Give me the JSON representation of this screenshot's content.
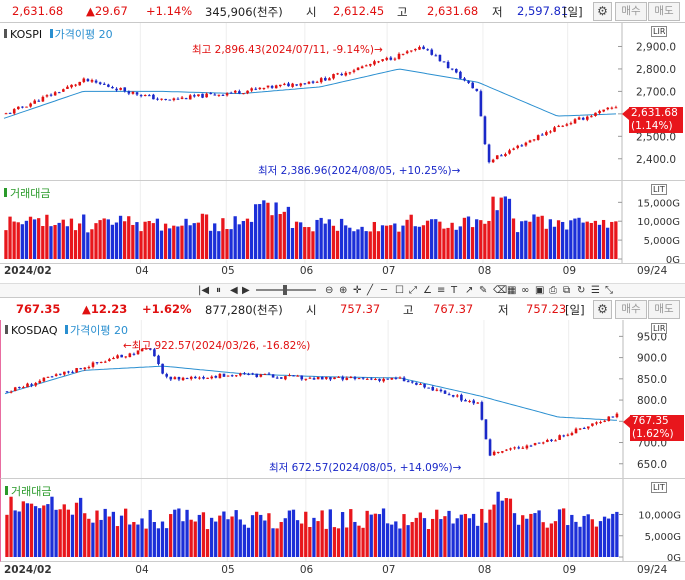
{
  "top": {
    "header": {
      "price": "2,631.68",
      "change": "▲29.67",
      "change_pct": "+1.14%",
      "volume": "345,906(천주)",
      "open_label": "시",
      "open": "2,612.45",
      "high_label": "고",
      "high": "2,631.68",
      "low_label": "저",
      "low": "2,597.81",
      "period": "[일]",
      "btn_sell": "매수",
      "btn_buy": "매도"
    },
    "legend": {
      "index_name": "KOSPI",
      "ma_label": "가격이평 20"
    },
    "vol_legend": "거래대금",
    "annotations": {
      "high": "최고 2,896.43(2024/07/11, -9.14%)",
      "low": "최저 2,386.96(2024/08/05, +10.25%)"
    },
    "current_price": "2,631.68",
    "current_pct": "(1.14%)",
    "vol_ticks": [
      "15,000G",
      "10,000G",
      "5,000G",
      "0G"
    ]
  },
  "bottom": {
    "header": {
      "price": "767.35",
      "change": "▲12.23",
      "change_pct": "+1.62%",
      "volume": "877,280(천주)",
      "open_label": "시",
      "open": "757.37",
      "high_label": "고",
      "high": "767.37",
      "low_label": "저",
      "low": "757.23",
      "period": "[일]",
      "btn_sell": "매수",
      "btn_buy": "매도"
    },
    "legend": {
      "index_name": "KOSDAQ",
      "ma_label": "가격이평 20"
    },
    "vol_legend": "거래대금",
    "annotations": {
      "high": "최고 922.57(2024/03/26, -16.82%)",
      "low": "최저 672.57(2024/08/05, +14.09%)"
    },
    "current_price": "767.35",
    "current_pct": "(1.62%)",
    "vol_ticks": [
      "10,000G",
      "5,000G",
      "0G"
    ]
  },
  "x_axis": {
    "start_label": "2024/02",
    "end_label": "09/24",
    "month_labels": [
      "04",
      "05",
      "06",
      "07",
      "08",
      "09"
    ]
  },
  "icons": {
    "settings": "gear-icon"
  },
  "colors": {
    "up": "#e01010",
    "down": "#1a28c8",
    "ma": "#2a8fd0",
    "vol_up": "#e8161c",
    "vol_down": "#1c2fd8"
  },
  "chart_data": [
    {
      "type": "candlestick",
      "title": "KOSPI",
      "series": [
        {
          "name": "KOSPI",
          "x": [
            "2024/02",
            "2024/03",
            "2024/04",
            "2024/05",
            "2024/06",
            "2024/07",
            "2024/07/11",
            "2024/08",
            "2024/08/05",
            "2024/09",
            "2024/09/24"
          ],
          "values": [
            2600,
            2750,
            2660,
            2700,
            2750,
            2860,
            2896.43,
            2700,
            2386.96,
            2540,
            2631.68
          ]
        },
        {
          "name": "가격이평 20",
          "x": [
            "2024/02",
            "2024/03",
            "2024/04",
            "2024/05",
            "2024/06",
            "2024/07",
            "2024/08",
            "2024/09",
            "2024/09/24"
          ],
          "values": [
            2580,
            2700,
            2700,
            2690,
            2720,
            2800,
            2740,
            2590,
            2600
          ]
        }
      ],
      "y_ticks": [
        2400,
        2500,
        2600,
        2700,
        2800,
        2900
      ],
      "ylim": [
        2350,
        2960
      ],
      "volume_ylim_G": [
        0,
        18000
      ]
    },
    {
      "type": "candlestick",
      "title": "KOSDAQ",
      "series": [
        {
          "name": "KOSDAQ",
          "x": [
            "2024/02",
            "2024/03",
            "2024/03/26",
            "2024/04",
            "2024/05",
            "2024/06",
            "2024/07",
            "2024/08",
            "2024/08/05",
            "2024/09",
            "2024/09/24"
          ],
          "values": [
            820,
            880,
            922.57,
            850,
            860,
            850,
            850,
            790,
            672.57,
            710,
            767.35
          ]
        },
        {
          "name": "가격이평 20",
          "x": [
            "2024/02",
            "2024/03",
            "2024/04",
            "2024/05",
            "2024/06",
            "2024/07",
            "2024/08",
            "2024/09",
            "2024/09/24"
          ],
          "values": [
            815,
            870,
            880,
            862,
            855,
            852,
            810,
            760,
            752
          ]
        }
      ],
      "y_ticks": [
        650,
        700,
        750,
        800,
        850,
        900,
        950
      ],
      "ylim": [
        640,
        965
      ],
      "volume_ylim_G": [
        0,
        16000
      ]
    }
  ]
}
